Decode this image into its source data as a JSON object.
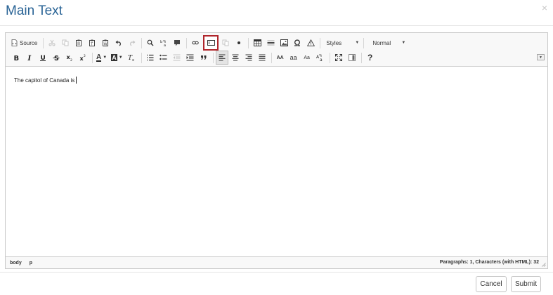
{
  "modal": {
    "title": "Main Text",
    "close_label": "×"
  },
  "toolbar": {
    "source_label": "Source",
    "styles_label": "Styles",
    "format_label": "Normal",
    "text_color_label": "A",
    "bg_color_label": "A",
    "uppercase_label": "AA",
    "lowercase_label": "aa",
    "sentence_case_label": "Aa",
    "help_label": "?"
  },
  "content": {
    "text": "The capitol of Canada is"
  },
  "status": {
    "path": [
      "body",
      "p"
    ],
    "word_count": "Paragraphs: 1, Characters (with HTML): 32"
  },
  "footer": {
    "cancel_label": "Cancel",
    "submit_label": "Submit"
  },
  "colors": {
    "title": "#2a6496",
    "highlight": "#b0262c"
  }
}
